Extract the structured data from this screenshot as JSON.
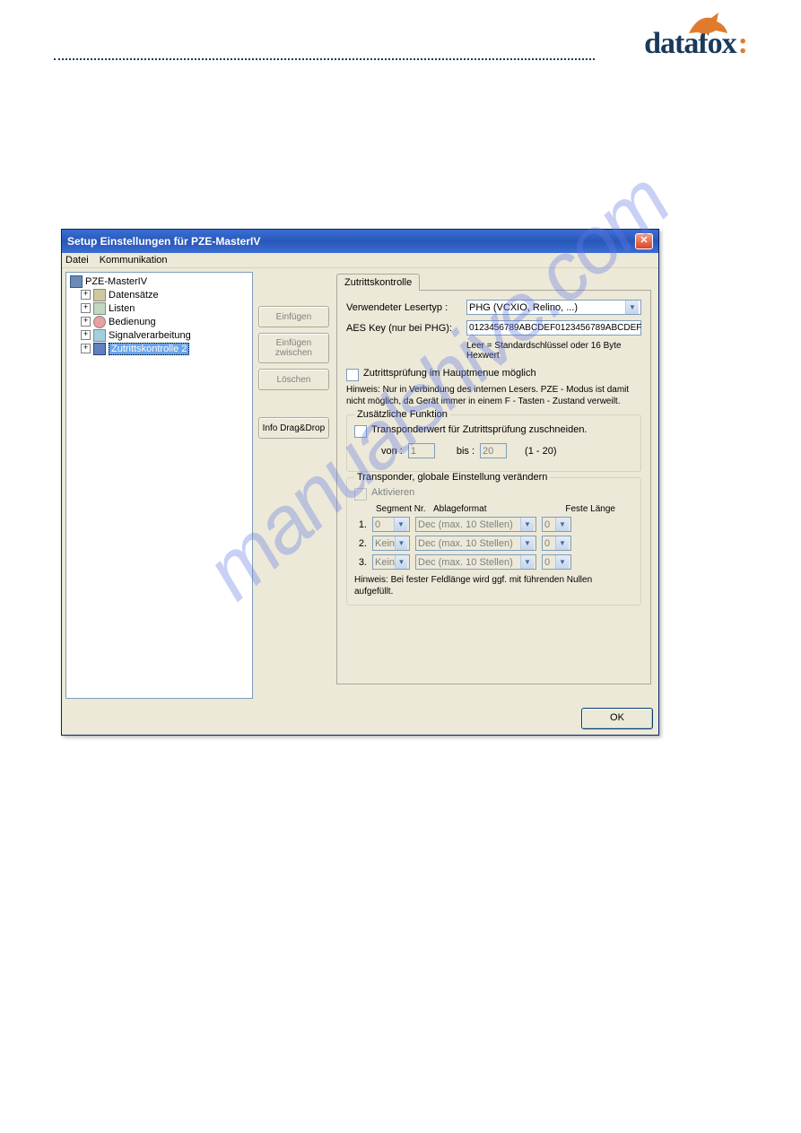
{
  "logo_text": "datafox",
  "window": {
    "title": "Setup Einstellungen für PZE-MasterIV",
    "menubar": {
      "datei": "Datei",
      "kom": "Kommunikation"
    },
    "tree": {
      "root": "PZE-MasterIV",
      "items": [
        "Datensätze",
        "Listen",
        "Bedienung",
        "Signalverarbeitung",
        "Zutrittskontrolle 2"
      ]
    },
    "buttons": {
      "einfuegen": "Einfügen",
      "einfuegen_zwischen_1": "Einfügen",
      "einfuegen_zwischen_2": "zwischen",
      "loeschen": "Löschen",
      "info_dd": "Info Drag&Drop"
    },
    "tab": "Zutrittskontrolle",
    "reader_label": "Verwendeter Lesertyp :",
    "reader_value": "PHG (VCXIO, Relino, ...)",
    "aes_label": "AES Key (nur bei PHG):",
    "aes_value": "0123456789ABCDEF0123456789ABCDEF",
    "aes_help": "Leer = Standardschlüssel oder 16 Byte Hexwert",
    "main_cb": "Zutrittsprüfung im Hauptmenue möglich",
    "hint_label": "Hinweis:",
    "hint_text": "Nur in Verbindung des internen Lesers. PZE - Modus ist damit nicht möglich, da Gerät immer in einem F - Tasten - Zustand verweilt.",
    "group1": {
      "title": "Zusätzliche Funktion",
      "cb": "Transponderwert für Zutrittsprüfung zuschneiden.",
      "von": "von :",
      "von_val": "1",
      "bis": "bis :",
      "bis_val": "20",
      "range": "(1 - 20)"
    },
    "group2": {
      "title": "Transponder, globale Einstellung verändern",
      "cb": "Aktivieren",
      "hdr_seg": "Segment Nr.",
      "hdr_format": "Ablageformat",
      "hdr_len": "Feste Länge",
      "rows": [
        {
          "n": "1.",
          "seg": "0",
          "fmt": "Dec (max. 10 Stellen)",
          "len": "0"
        },
        {
          "n": "2.",
          "seg": "Kein",
          "fmt": "Dec (max. 10 Stellen)",
          "len": "0"
        },
        {
          "n": "3.",
          "seg": "Kein",
          "fmt": "Dec (max. 10 Stellen)",
          "len": "0"
        }
      ],
      "hint": "Hinweis: Bei fester Feldlänge wird ggf. mit führenden Nullen aufgefüllt."
    },
    "ok": "OK"
  },
  "watermark": "manualshive.com"
}
